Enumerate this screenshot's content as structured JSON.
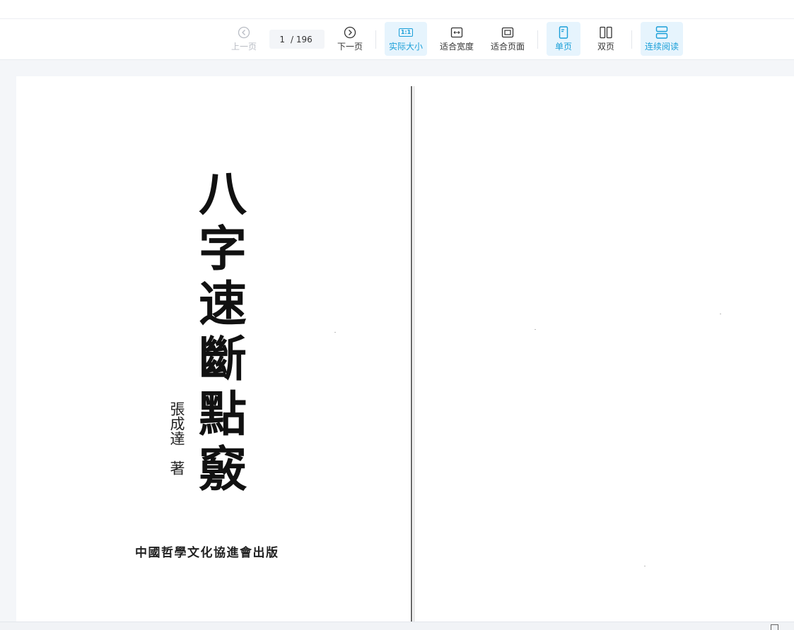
{
  "toolbar": {
    "prev_label": "上一页",
    "next_label": "下一页",
    "page_current": "1",
    "page_total": "/ 196",
    "actual_size_label": "实际大小",
    "actual_size_icon_text": "1:1",
    "fit_width_label": "适合宽度",
    "fit_page_label": "适合页面",
    "single_page_label": "单页",
    "double_page_label": "双页",
    "continuous_label": "连续阅读",
    "accent_color": "#1a9fd8",
    "active_bg": "#e6f4fd"
  },
  "document": {
    "title_chars": [
      "八",
      "字",
      "速",
      "斷",
      "點",
      "竅"
    ],
    "author": "張成達　著",
    "publisher": "中國哲學文化協進會出版"
  }
}
